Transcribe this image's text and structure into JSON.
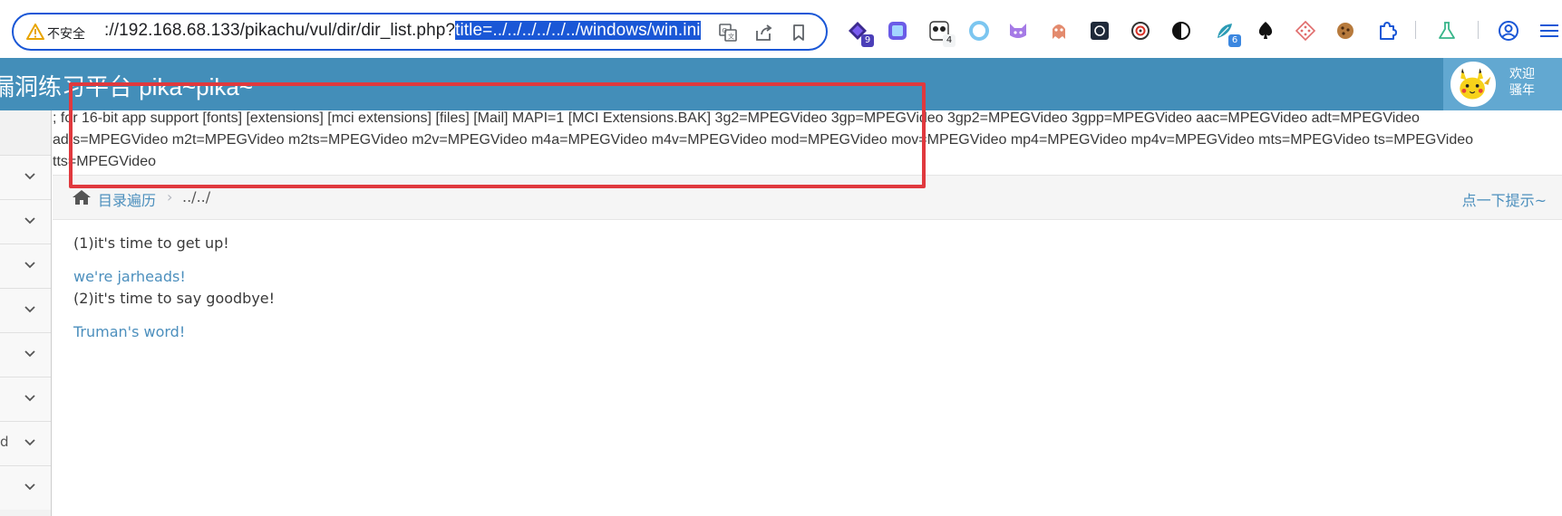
{
  "browser": {
    "insecure_label": "不安全",
    "url_prefix": "://192.168.68.133/pikachu/vul/dir/dir_list.php?",
    "url_selected": "title=../../../../../../windows/win.ini",
    "extensions": [
      {
        "icon": "purple-diamond-icon",
        "badge": "9",
        "badge_color": "#4b3fb8"
      },
      {
        "icon": "purple-square-icon",
        "badge": ""
      },
      {
        "icon": "panda-icon",
        "badge": "4",
        "badge_color": "#f1f3f4"
      },
      {
        "icon": "blue-ring-icon",
        "badge": ""
      },
      {
        "icon": "purple-cat-icon",
        "badge": ""
      },
      {
        "icon": "orange-ghost-icon",
        "badge": ""
      },
      {
        "icon": "dark-square-icon",
        "badge": ""
      },
      {
        "icon": "target-icon",
        "badge": ""
      },
      {
        "icon": "half-circle-icon",
        "badge": ""
      },
      {
        "icon": "feather-icon",
        "badge": "6",
        "badge_color": "#3b87e0"
      },
      {
        "icon": "spade-icon",
        "badge": ""
      },
      {
        "icon": "diamond-dots-icon",
        "badge": ""
      },
      {
        "icon": "cookie-icon",
        "badge": ""
      },
      {
        "icon": "puzzle-icon",
        "badge": ""
      },
      {
        "icon": "flask-icon",
        "badge": ""
      },
      {
        "icon": "profile-icon",
        "badge": ""
      },
      {
        "icon": "menu-icon",
        "badge": ""
      }
    ]
  },
  "header": {
    "title": "漏洞练习平台 pika~pika~",
    "welcome_line1": "欢迎",
    "welcome_line2": "骚年"
  },
  "sidebar": {
    "rows": [
      {
        "fragment": ""
      },
      {
        "fragment": ""
      },
      {
        "fragment": ""
      },
      {
        "fragment": ""
      },
      {
        "fragment": ""
      },
      {
        "fragment": ""
      },
      {
        "fragment": "d"
      },
      {
        "fragment": ""
      }
    ]
  },
  "file_output": {
    "lines": [
      "; for 16-bit app support [fonts] [extensions] [mci extensions] [files] [Mail] MAPI=1 [MCI Extensions.BAK] 3g2=MPEGVideo 3gp=MPEGVideo 3gp2=MPEGVideo 3gpp=MPEGVideo aac=MPEGVideo adt=MPEGVideo",
      "adts=MPEGVideo m2t=MPEGVideo m2ts=MPEGVideo m2v=MPEGVideo m4a=MPEGVideo m4v=MPEGVideo mod=MPEGVideo mov=MPEGVideo mp4=MPEGVideo mp4v=MPEGVideo mts=MPEGVideo ts=MPEGVideo",
      "tts=MPEGVideo"
    ]
  },
  "breadcrumb": {
    "link": "目录遍历",
    "separator": "›",
    "current": "../../",
    "hint": "点一下提示~"
  },
  "content": {
    "line1": "(1)it's time to get up!",
    "link1": "we're jarheads!",
    "line2": "(2)it's time to say goodbye!",
    "link2": "Truman's word!"
  },
  "colors": {
    "header_bg": "#438eb9",
    "user_box_bg": "#62a8d1",
    "link": "#4c8fbd",
    "annotation": "#e0393e",
    "omnibox_border": "#1a57d6"
  }
}
